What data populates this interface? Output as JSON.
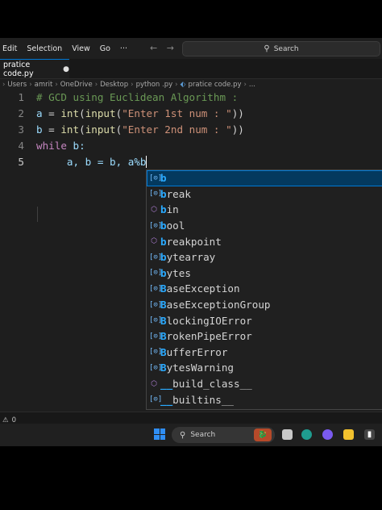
{
  "menu": {
    "items": [
      "Edit",
      "Selection",
      "View",
      "Go",
      "···"
    ]
  },
  "nav": {
    "back": "←",
    "forward": "→"
  },
  "search": {
    "label": "Search"
  },
  "tab": {
    "label": "pratice code.py",
    "modified": "●"
  },
  "breadcrumb": {
    "items": [
      "Users",
      "amrit",
      "OneDrive",
      "Desktop",
      "python .py",
      "pratice code.py",
      "..."
    ]
  },
  "editor": {
    "lines": [
      {
        "num": "1",
        "comment": "# GCD using Euclidean Algorithm :"
      },
      {
        "num": "2",
        "var": "a",
        "op": " = ",
        "fn1": "int",
        "p1": "(",
        "fn2": "input",
        "p2": "(",
        "str": "\"Enter 1st num : \"",
        "p3": "))"
      },
      {
        "num": "3",
        "var": "b",
        "op": " = ",
        "fn1": "int",
        "p1": "(",
        "fn2": "input",
        "p2": "(",
        "str": "\"Enter 2nd num : \"",
        "p3": "))"
      },
      {
        "num": "4",
        "kw": "while",
        "rest": " b:"
      },
      {
        "num": "5",
        "code": "     a, b = b, a%b"
      }
    ]
  },
  "suggestions": [
    {
      "icon": "[⊙]",
      "kind": "variable",
      "match": "b",
      "rest": ""
    },
    {
      "icon": "[⊙]",
      "kind": "variable",
      "match": "b",
      "rest": "reak"
    },
    {
      "icon": "⬡",
      "kind": "module",
      "match": "b",
      "rest": "in"
    },
    {
      "icon": "[⊙]",
      "kind": "variable",
      "match": "b",
      "rest": "ool"
    },
    {
      "icon": "⬡",
      "kind": "module",
      "match": "b",
      "rest": "reakpoint"
    },
    {
      "icon": "[⊙]",
      "kind": "variable",
      "match": "b",
      "rest": "ytearray"
    },
    {
      "icon": "[⊙]",
      "kind": "variable",
      "match": "b",
      "rest": "ytes"
    },
    {
      "icon": "[⊙]",
      "kind": "variable",
      "match": "B",
      "rest": "aseException"
    },
    {
      "icon": "[⊙]",
      "kind": "variable",
      "match": "B",
      "rest": "aseExceptionGroup"
    },
    {
      "icon": "[⊙]",
      "kind": "variable",
      "match": "B",
      "rest": "lockingIOError"
    },
    {
      "icon": "[⊙]",
      "kind": "variable",
      "match": "B",
      "rest": "rokenPipeError"
    },
    {
      "icon": "[⊙]",
      "kind": "variable",
      "match": "B",
      "rest": "ufferError"
    },
    {
      "icon": "[⊙]",
      "kind": "variable",
      "match": "B",
      "rest": "ytesWarning"
    },
    {
      "icon": "⬡",
      "kind": "module",
      "match": "__",
      "rest": "build_class__"
    },
    {
      "icon": "[⊙]",
      "kind": "variable",
      "match": "__",
      "rest": "builtins__"
    }
  ],
  "status": {
    "warning_icon": "⚠",
    "count": "0"
  },
  "taskbar": {
    "search_label": "Search",
    "badge": "🐉"
  },
  "colors": {
    "accent": "#0078d4",
    "comment": "#6a9955",
    "keyword": "#c586c0",
    "function": "#dcdcaa",
    "string": "#ce9178"
  }
}
